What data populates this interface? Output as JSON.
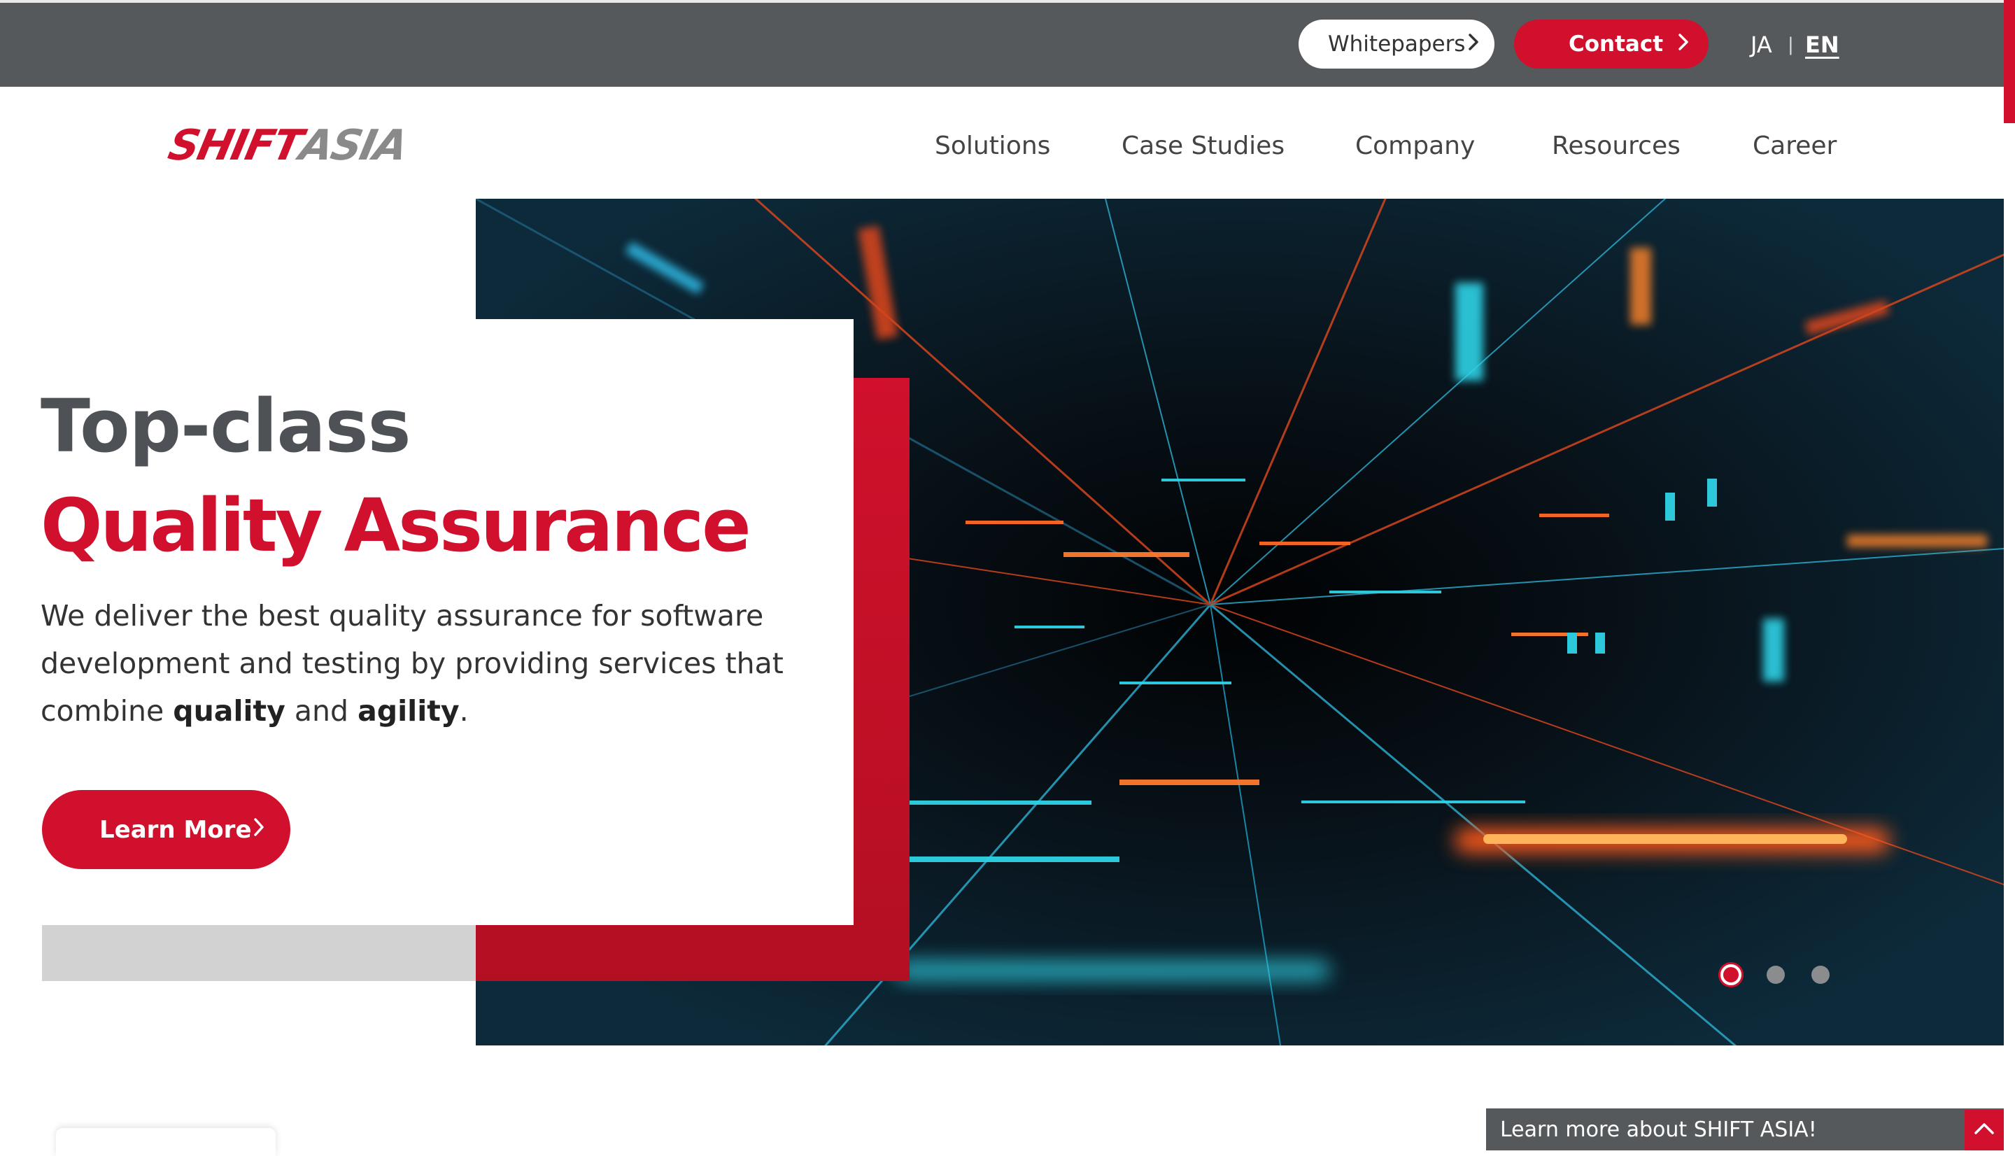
{
  "topbar": {
    "whitepapers_label": "Whitepapers",
    "contact_label": "Contact",
    "lang_ja": "JA",
    "lang_separator": "|",
    "lang_en": "EN"
  },
  "nav": {
    "logo_part1": "SHIFT",
    "logo_part2": "ASIA",
    "items": [
      {
        "label": "Solutions"
      },
      {
        "label": "Case Studies"
      },
      {
        "label": "Company"
      },
      {
        "label": "Resources"
      },
      {
        "label": "Career"
      }
    ]
  },
  "hero": {
    "title_line1": "Top-class",
    "title_line2": "Quality Assurance",
    "desc_part1": "We deliver the best quality assurance for software development and testing by providing services that combine ",
    "desc_bold1": "quality",
    "desc_part2": " and ",
    "desc_bold2": "agility",
    "desc_part3": ".",
    "cta_label": "Learn More",
    "slides_total": 3,
    "slide_active": 1
  },
  "footer_bar": {
    "label": "Learn more about SHIFT ASIA!"
  },
  "colors": {
    "brand_red": "#d0102c",
    "topbar_grey": "#55595c",
    "heading_grey": "#4e5256"
  },
  "icons": {
    "chevron": "chevron-right-icon",
    "toggle": "chevron-up-icon"
  }
}
